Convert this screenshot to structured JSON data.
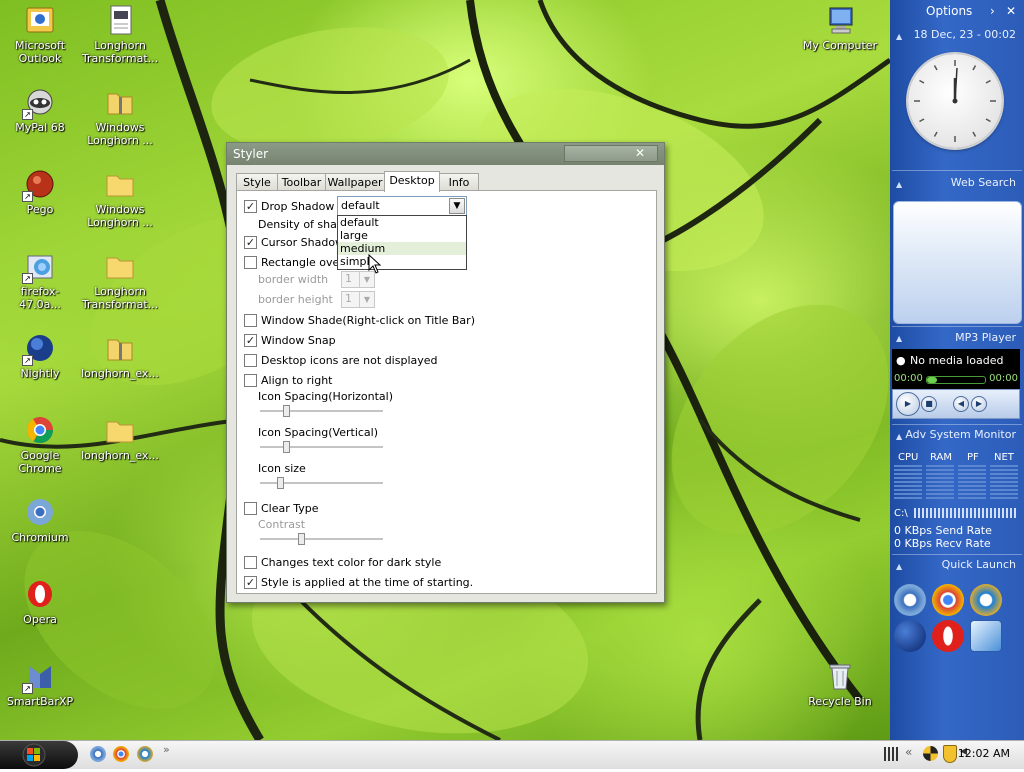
{
  "desktop": {
    "icons": [
      {
        "label": "Microsoft Outlook",
        "icon": "outlook-icon"
      },
      {
        "label": "Longhorn Transformat...",
        "icon": "document-icon"
      },
      {
        "label": "MyPal 68",
        "icon": "mypal-icon"
      },
      {
        "label": "Windows Longhorn ...",
        "icon": "zip-folder-icon"
      },
      {
        "label": "Pego",
        "icon": "pego-icon"
      },
      {
        "label": "Windows Longhorn ...",
        "icon": "folder-icon"
      },
      {
        "label": "firefox-47.0a...",
        "icon": "installer-icon"
      },
      {
        "label": "Longhorn Transformat...",
        "icon": "folder-icon"
      },
      {
        "label": "Nightly",
        "icon": "nightly-icon"
      },
      {
        "label": "longhorn_ex...",
        "icon": "zip-folder-icon"
      },
      {
        "label": "Google Chrome",
        "icon": "chrome-icon"
      },
      {
        "label": "longhorn_ex...",
        "icon": "folder-icon"
      },
      {
        "label": "Chromium",
        "icon": "chromium-icon"
      },
      {
        "label": "Opera",
        "icon": "opera-icon"
      },
      {
        "label": "SmartBarXP",
        "icon": "smartbar-icon"
      },
      {
        "label": "My Computer",
        "icon": "computer-icon"
      },
      {
        "label": "Recycle Bin",
        "icon": "recycle-bin-icon"
      }
    ]
  },
  "styler": {
    "title": "Styler",
    "close_glyph": "✕",
    "tabs": [
      "Style",
      "Toolbar",
      "Wallpaper",
      "Desktop",
      "Info"
    ],
    "active_tab": "Desktop",
    "drop_shadow": {
      "label": "Drop Shadow",
      "checked": true
    },
    "density_label": "Density of shado",
    "combo_value": "default",
    "dropdown_options": [
      "default",
      "large",
      "medium",
      "simple"
    ],
    "highlighted_option": "medium",
    "cursor_shadow": {
      "label": "Cursor Shadow",
      "checked": true
    },
    "rectangle_over": {
      "label": "Rectangle over t",
      "checked": false
    },
    "border_width": {
      "label": "border width",
      "value": "1"
    },
    "border_height": {
      "label": "border height",
      "value": "1"
    },
    "window_shade": {
      "label": "Window Shade(Right-click on Title Bar)",
      "checked": false
    },
    "window_snap": {
      "label": "Window Snap",
      "checked": true
    },
    "desktop_icons_hidden": {
      "label": "Desktop icons are not displayed",
      "checked": false
    },
    "align_right": {
      "label": "Align to right",
      "checked": false
    },
    "icon_spacing_h": {
      "label": "Icon Spacing(Horizontal)",
      "level": 0.2
    },
    "icon_spacing_v": {
      "label": "Icon Spacing(Vertical)",
      "level": 0.2
    },
    "icon_size": {
      "label": "Icon size",
      "level": 0.15
    },
    "clear_type": {
      "label": "Clear Type",
      "checked": false
    },
    "contrast": {
      "label": "Contrast",
      "level": 0.33
    },
    "dark_style": {
      "label": "Changes text color for dark style",
      "checked": false
    },
    "apply_on_start": {
      "label": "Style is applied at the time of starting.",
      "checked": true
    }
  },
  "sidebar": {
    "options_label": "Options",
    "date_time": "18 Dec, 23 - 00:02",
    "web_search_title": "Web Search",
    "mp3_title": "MP3 Player",
    "media_status": "No media loaded",
    "time_elapsed": "00:00",
    "time_total": "00:00",
    "monitor_title": "Adv System Monitor",
    "monitor_columns": [
      "CPU",
      "RAM",
      "PF",
      "NET"
    ],
    "drive_label": "C:\\",
    "send_rate": "0 KBps Send Rate",
    "recv_rate": "0 KBps Recv Rate",
    "quick_launch_title": "Quick Launch"
  },
  "taskbar": {
    "time": "12:02 AM",
    "overflow": "»"
  }
}
